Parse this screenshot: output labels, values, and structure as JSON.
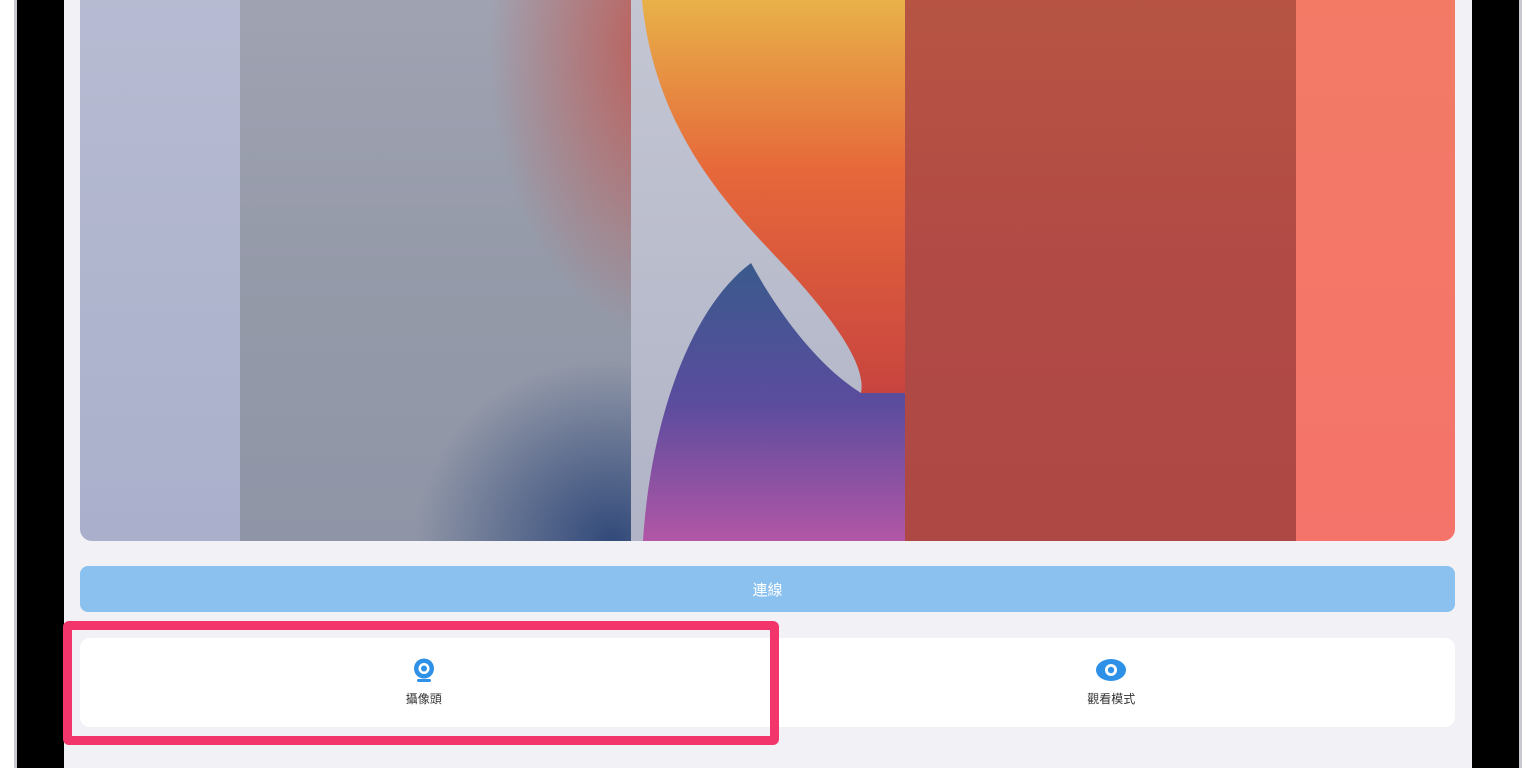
{
  "connect_button": {
    "label": "連線"
  },
  "modes": [
    {
      "label": "攝像頭",
      "icon": "webcam-icon",
      "selected": true
    },
    {
      "label": "觀看模式",
      "icon": "eye-icon",
      "selected": false
    }
  ],
  "colors": {
    "accent": "#2e90e6",
    "connect_button_bg": "#8bc1ef",
    "highlight": "#f2356b",
    "screen_bg": "#f2f2f6"
  }
}
